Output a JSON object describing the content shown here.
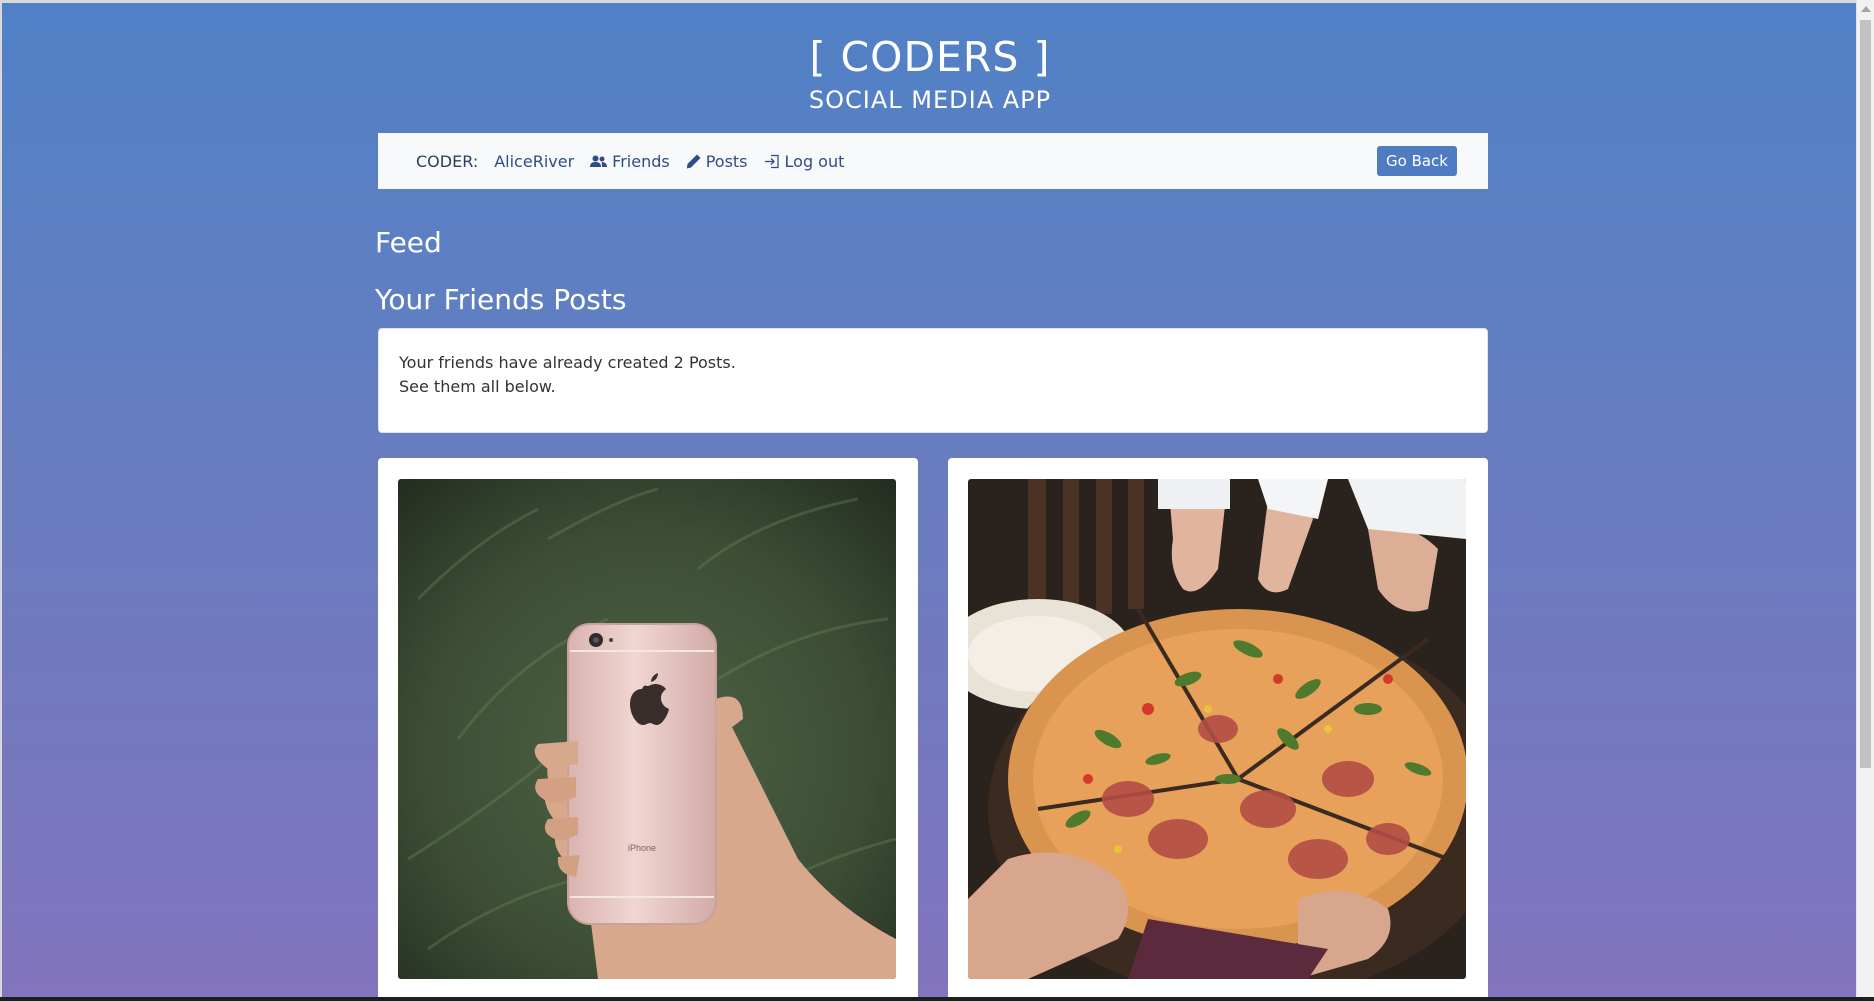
{
  "header": {
    "title": "[ CODERS ]",
    "subtitle": "SOCIAL MEDIA APP"
  },
  "navbar": {
    "coder_label": "CODER:",
    "username": "AliceRiver",
    "friends_label": "Friends",
    "posts_label": "Posts",
    "logout_label": "Log out",
    "go_back_label": "Go Back"
  },
  "feed": {
    "heading": "Feed",
    "friends_posts_heading": "Your Friends Posts",
    "info_line1": "Your friends have already created 2 Posts.",
    "info_line2": "See them all below."
  },
  "posts": [
    {
      "image_alt": "hand holding a rose gold iPhone in a grass field",
      "phone_text": "iPhone"
    },
    {
      "image_alt": "hands taking slices of pizza from a table"
    }
  ],
  "colors": {
    "gradient_top": "#5081c6",
    "gradient_bottom": "#8274bd",
    "nav_text": "#2f4d85",
    "button_bg": "#4f7cc0"
  }
}
